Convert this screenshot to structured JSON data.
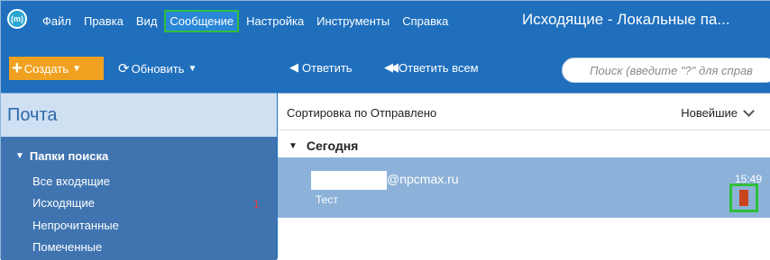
{
  "app": {
    "logo_text": "(m)",
    "window_title": "Исходящие - Локальные па..."
  },
  "menu": {
    "items": [
      {
        "label": "Файл"
      },
      {
        "label": "Правка"
      },
      {
        "label": "Вид"
      },
      {
        "label": "Сообщение",
        "highlighted": true
      },
      {
        "label": "Настройка"
      },
      {
        "label": "Инструменты"
      },
      {
        "label": "Справка"
      }
    ]
  },
  "toolbar": {
    "create_label": "Создать",
    "refresh_label": "Обновить",
    "reply_label": "Ответить",
    "reply_all_label": "Ответить всем",
    "search_placeholder": "Поиск (введите \"?\" для справ"
  },
  "sidebar": {
    "title": "Почта",
    "group_label": "Папки поиска",
    "folders": [
      {
        "label": "Все входящие"
      },
      {
        "label": "Исходящие",
        "count": "1"
      },
      {
        "label": "Непрочитанные"
      },
      {
        "label": "Помеченные"
      }
    ]
  },
  "message_list": {
    "sort_label": "Сортировка по Отправлено",
    "sort_order": "Новейшие",
    "group_label": "Сегодня",
    "message": {
      "sender": "@npcmax.ru",
      "subject": "Тест",
      "time": "15:49"
    }
  },
  "colors": {
    "accent": "#1f6fbd",
    "create_button": "#f0a11f",
    "selected_row": "#8db2d9",
    "highlight_border": "#2fbf3b",
    "flag": "#c8461d"
  }
}
